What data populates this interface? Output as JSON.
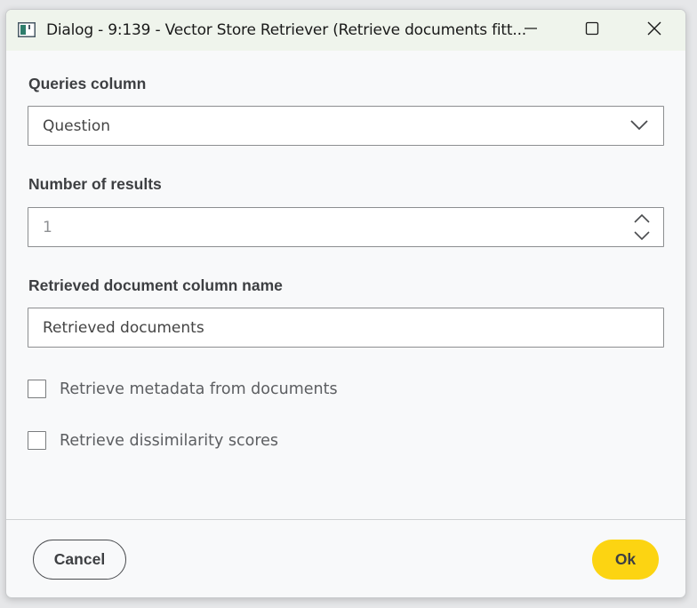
{
  "window": {
    "title": "Dialog - 9:139 - Vector Store Retriever (Retrieve documents fitt...",
    "minimize_icon": "minimize-icon",
    "maximize_icon": "maximize-icon",
    "close_icon": "close-icon"
  },
  "queries": {
    "label": "Queries column",
    "value": "Question"
  },
  "results": {
    "label": "Number of results",
    "value": "1"
  },
  "doc_column": {
    "label": "Retrieved document column name",
    "value": "Retrieved documents"
  },
  "options": [
    {
      "label": "Retrieve metadata from documents",
      "checked": false
    },
    {
      "label": "Retrieve dissimilarity scores",
      "checked": false
    }
  ],
  "footer": {
    "cancel_label": "Cancel",
    "ok_label": "Ok"
  },
  "colors": {
    "ok_button": "#fcd412",
    "titlebar": "#eff4ec"
  }
}
